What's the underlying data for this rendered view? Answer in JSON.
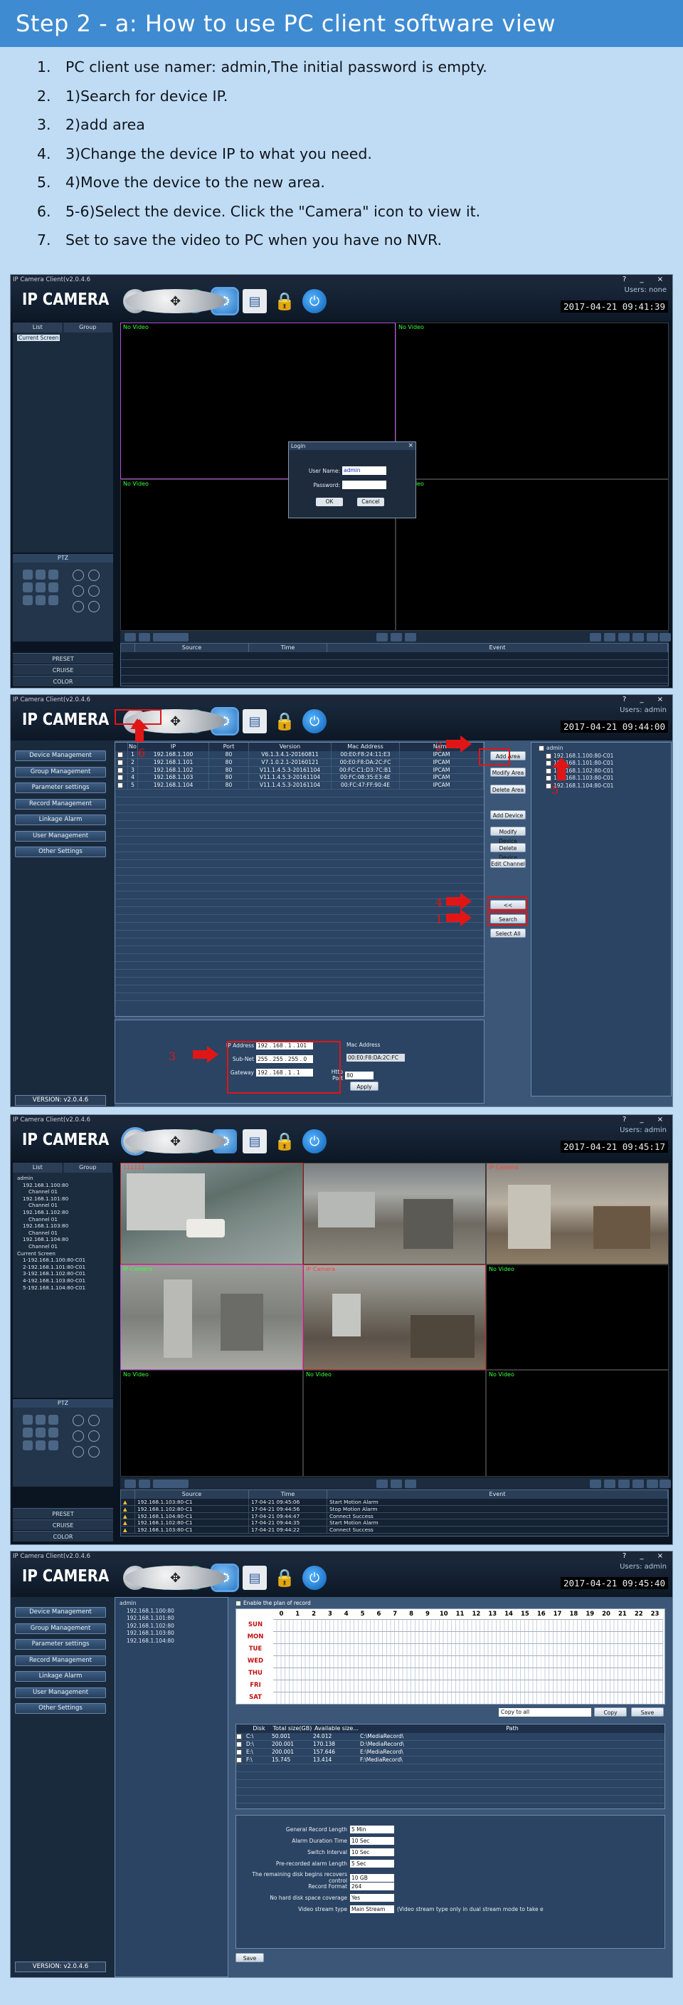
{
  "header": {
    "title": "Step 2 - a:  How to use PC client software view"
  },
  "steps": [
    {
      "num": "1.",
      "text": "PC client use namer: admin,The initial password is empty."
    },
    {
      "num": "2.",
      "text": "1)Search for device IP."
    },
    {
      "num": "3.",
      "text": "2)add area"
    },
    {
      "num": "4.",
      "text": "3)Change the device IP to what you need."
    },
    {
      "num": "5.",
      "text": "4)Move the device to the new area."
    },
    {
      "num": "6.",
      "text": "5-6)Select the device. Click the \"Camera\" icon to view it."
    },
    {
      "num": "7.",
      "text": "Set to save the video to PC when you have no NVR."
    }
  ],
  "app": {
    "window_title": "IP Camera Client(v2.0.4.6",
    "brand": "IP CAMERA",
    "version": "VERSION: v2.0.4.6",
    "colors": {
      "accent": "#3f8bd2",
      "live": "#3aff3a",
      "annot": "#e01616"
    }
  },
  "win1": {
    "users": "Users: none",
    "clock": "2017-04-21  09:41:39",
    "tabs": [
      "List",
      "Group"
    ],
    "tree": [
      "Current Screen"
    ],
    "ptz_label": "PTZ",
    "ptz_buttons": [
      "PRESET",
      "CRUISE",
      "COLOR"
    ],
    "cells": [
      "No Video",
      "No Video",
      "No Video",
      "No Video"
    ],
    "login": {
      "title": "Login",
      "user_label": "User Name:",
      "user_value": "admin",
      "pass_label": "Password:",
      "ok": "OK",
      "cancel": "Cancel"
    },
    "event_headers": [
      "",
      "Source",
      "Time",
      "Event"
    ]
  },
  "win2": {
    "users": "Users: admin",
    "clock": "2017-04-21  09:44:00",
    "menu": [
      "Device Management",
      "Group Management",
      "Parameter settings",
      "Record Management",
      "Linkage Alarm",
      "User Management",
      "Other Settings"
    ],
    "grid_headers": [
      "",
      "No",
      "IP",
      "Port",
      "Version",
      "Mac Address",
      "Name"
    ],
    "grid_rows": [
      [
        "1",
        "192.168.1.100",
        "80",
        "V6.1.3.4.1-20160811",
        "00:E0:F8:24:11:E3",
        "IPCAM"
      ],
      [
        "2",
        "192.168.1.101",
        "80",
        "V7.1.0.2.1-20160121",
        "00:E0:F8:DA:2C:FC",
        "IPCAM"
      ],
      [
        "3",
        "192.168.1.102",
        "80",
        "V11.1.4.5.3-20161104",
        "00:FC:C1:D3:7C:B1",
        "IPCAM"
      ],
      [
        "4",
        "192.168.1.103",
        "80",
        "V11.1.4.5.3-20161104",
        "00:FC:08:35:E3:4E",
        "IPCAM"
      ],
      [
        "5",
        "192.168.1.104",
        "80",
        "V11.1.4.5.3-20161104",
        "00:FC:47:FF:90:4E",
        "IPCAM"
      ]
    ],
    "buttons_top": [
      "Add Area",
      "Modify Area",
      "Delete Area"
    ],
    "buttons_mid": [
      "Add Device",
      "Modify Device",
      "Delete Device",
      "Edit Channel"
    ],
    "buttons_bottom": [
      "<<",
      "Search",
      "Select All"
    ],
    "area_tree": [
      "admin",
      "192.168.1.100:80-C01",
      "192.168.1.101:80-C01",
      "192.168.1.102:80-C01",
      "192.168.1.103:80-C01",
      "192.168.1.104:80-C01"
    ],
    "net": {
      "ip_label": "IP Address",
      "ip": "192 . 168 . 1 . 101",
      "mask_label": "Sub-Net",
      "mask": "255 . 255 . 255 . 0",
      "gw_label": "Gateway",
      "gw": "192 . 168 . 1 . 1",
      "mac_label": "Mac Address",
      "mac": "00:E0:F8:DA:2C:FC",
      "http_label": "Http Port",
      "http": "80",
      "apply": "Apply"
    },
    "annotations": [
      "1",
      "2",
      "3",
      "4",
      "5",
      "6"
    ]
  },
  "win3": {
    "users": "Users: admin",
    "clock": "2017-04-21  09:45:17",
    "tabs": [
      "List",
      "Group"
    ],
    "tree": [
      "admin",
      "192.168.1.100:80",
      "Channel 01",
      "192.168.1.101:80",
      "Channel 01",
      "192.168.1.102:80",
      "Channel 01",
      "192.168.1.103:80",
      "Channel 01",
      "192.168.1.104:80",
      "Channel 01",
      "Current Screen",
      "1-192.168.1.100:80-C01",
      "2-192.168.1.101:80-C01",
      "3-192.168.1.102:80-C01",
      "4-192.168.1.103:80-C01",
      "5-192.168.1.104:80-C01"
    ],
    "cells": [
      "111111",
      "",
      "IP Camera",
      "IP Camera",
      "IP Camera",
      "No Video",
      "No Video",
      "No Video",
      "No Video"
    ],
    "ptz_label": "PTZ",
    "ptz_buttons": [
      "PRESET",
      "CRUISE",
      "COLOR"
    ],
    "event_headers": [
      "",
      "Source",
      "Time",
      "Event"
    ],
    "events": [
      [
        "192.168.1.103:80-C1",
        "17-04-21 09:45:06",
        "Start Motion Alarm"
      ],
      [
        "192.168.1.102:80-C1",
        "17-04-21 09:44:56",
        "Stop Motion Alarm"
      ],
      [
        "192.168.1.104:80-C1",
        "17-04-21 09:44:47",
        "Connect Success"
      ],
      [
        "192.168.1.102:80-C1",
        "17-04-21 09:44:35",
        "Start Motion Alarm"
      ],
      [
        "192.168.1.103:80-C1",
        "17-04-21 09:44:22",
        "Connect Success"
      ]
    ]
  },
  "win4": {
    "users": "Users: admin",
    "clock": "2017-04-21  09:45:40",
    "menu": [
      "Device Management",
      "Group Management",
      "Parameter settings",
      "Record Management",
      "Linkage Alarm",
      "User Management",
      "Other Settings"
    ],
    "tree": [
      "admin",
      "192.168.1.100:80",
      "192.168.1.101:80",
      "192.168.1.102:80",
      "192.168.1.103:80",
      "192.168.1.104:80"
    ],
    "enable_plan": "Enable the plan of record",
    "hours": [
      "0",
      "1",
      "2",
      "3",
      "4",
      "5",
      "6",
      "7",
      "8",
      "9",
      "10",
      "11",
      "12",
      "13",
      "14",
      "15",
      "16",
      "17",
      "18",
      "19",
      "20",
      "21",
      "22",
      "23"
    ],
    "days": [
      "SUN",
      "MON",
      "TUE",
      "WED",
      "THU",
      "FRI",
      "SAT"
    ],
    "copy_select": "Copy to all",
    "copy_btn": "Copy",
    "save_btn": "Save",
    "disk_headers": [
      "",
      "Disk",
      "Total size(GB)",
      "Available size...",
      "Path"
    ],
    "disks": [
      [
        "C:\\",
        "50.001",
        "24.012",
        "C:\\MediaRecord\\"
      ],
      [
        "D:\\",
        "200.001",
        "170.138",
        "D:\\MediaRecord\\"
      ],
      [
        "E:\\",
        "200.001",
        "157.646",
        "E:\\MediaRecord\\"
      ],
      [
        "F:\\",
        "15.745",
        "13.414",
        "F:\\MediaRecord\\"
      ]
    ],
    "settings": [
      {
        "label": "General Record Length",
        "value": "5 Min"
      },
      {
        "label": "Alarm Duration Time",
        "value": "10 Sec"
      },
      {
        "label": "Switch Interval",
        "value": "10 Sec"
      },
      {
        "label": "Pre-recorded alarm Length",
        "value": "5 Sec"
      },
      {
        "label": "The remaining disk begins recovers control",
        "value": "10 GB"
      },
      {
        "label": "Record Format",
        "value": "264"
      },
      {
        "label": "No hard disk space coverage",
        "value": "Yes"
      },
      {
        "label": "Video stream type",
        "value": "Main Stream"
      }
    ],
    "stream_note": "(Video stream type only in dual stream mode to take e",
    "save_bottom": "Save"
  }
}
